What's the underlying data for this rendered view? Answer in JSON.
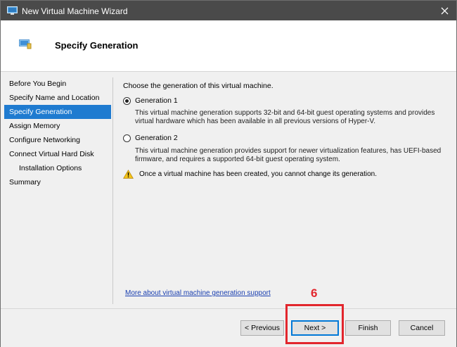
{
  "window": {
    "title": "New Virtual Machine Wizard"
  },
  "header": {
    "title": "Specify Generation"
  },
  "sidebar": {
    "items": [
      {
        "label": "Before You Begin"
      },
      {
        "label": "Specify Name and Location"
      },
      {
        "label": "Specify Generation"
      },
      {
        "label": "Assign Memory"
      },
      {
        "label": "Configure Networking"
      },
      {
        "label": "Connect Virtual Hard Disk"
      },
      {
        "label": "Installation Options"
      },
      {
        "label": "Summary"
      }
    ],
    "selected_index": 2
  },
  "main": {
    "intro": "Choose the generation of this virtual machine.",
    "options": [
      {
        "label": "Generation 1",
        "selected": true,
        "description": "This virtual machine generation supports 32-bit and 64-bit guest operating systems and provides virtual hardware which has been available in all previous versions of Hyper-V."
      },
      {
        "label": "Generation 2",
        "selected": false,
        "description": "This virtual machine generation provides support for newer virtualization features, has UEFI-based firmware, and requires a supported 64-bit guest operating system."
      }
    ],
    "warning": "Once a virtual machine has been created, you cannot change its generation.",
    "link": "More about virtual machine generation support"
  },
  "footer": {
    "previous_label": "< Previous",
    "next_label": "Next >",
    "finish_label": "Finish",
    "cancel_label": "Cancel"
  },
  "annotation": {
    "step_number": "6",
    "color": "#e2262d"
  },
  "colors": {
    "selection": "#1f7bd0",
    "titlebar": "#4a4a4a",
    "link": "#1a3fb0"
  }
}
